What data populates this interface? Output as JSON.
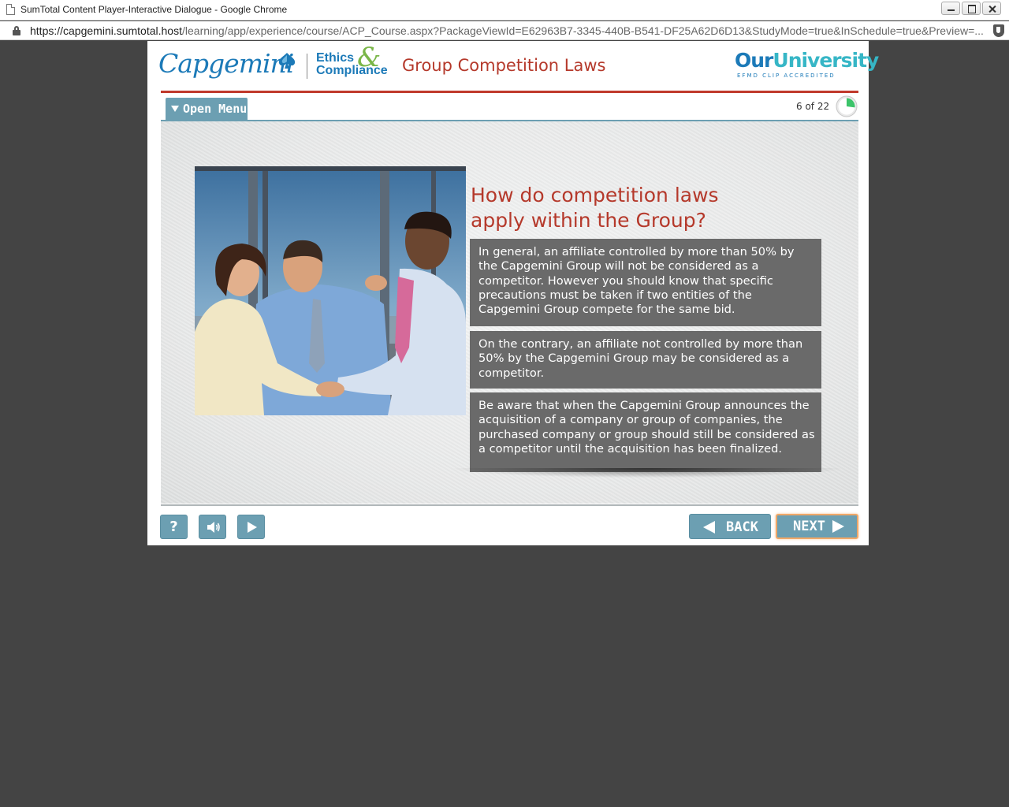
{
  "window": {
    "title": "SumTotal Content Player-Interactive Dialogue - Google Chrome"
  },
  "address_bar": {
    "host_part": "https://capgemini.sumtotal.host",
    "path_part": "/learning/app/experience/course/ACP_Course.aspx?PackageViewId=E62963B7-3345-440B-B541-DF25A62D6D13&StudyMode=true&InSchedule=true&Preview=..."
  },
  "header": {
    "brand": "Capgemini",
    "program_line1": "Ethics",
    "program_amp": "&",
    "program_line2": "Compliance",
    "course_title": "Group Competition Laws",
    "partner_our": "Our",
    "partner_university": "University",
    "partner_sub": "EFMD CLIP ACCREDITED"
  },
  "nav": {
    "menu_label": "Open Menu",
    "progress_text": "6 of 22",
    "progress_fraction": 0.27
  },
  "slide": {
    "heading_line1": "How do competition laws",
    "heading_line2": "apply within the Group?",
    "cards": [
      {
        "text": "In general, an affiliate controlled by more than 50% by the Capgemini Group will not be considered as a competitor. However you should know that specific precautions must be taken if two entities of the Capgemini Group compete for the same bid."
      },
      {
        "text": "On the contrary, an affiliate not controlled by more than 50% by the Capgemini Group may be considered as a competitor."
      },
      {
        "text": "Be aware that when the Capgemini Group announces the acquisition of a company or group of companies, the purchased company or group should still be considered as a competitor until the acquisition has been finalized."
      }
    ],
    "image_icon": "business-handshake-photo"
  },
  "footer": {
    "help_label": "?",
    "audio_icon": "speaker-icon",
    "play_icon": "play-icon",
    "back_label": "BACK",
    "next_label": "NEXT"
  },
  "colors": {
    "brand_blue": "#1c7ab8",
    "accent_red": "#b5392b",
    "button_teal": "#6c9fb2",
    "card_gray": "#6a6a6a",
    "next_highlight": "#f0a868",
    "background": "#444444"
  }
}
